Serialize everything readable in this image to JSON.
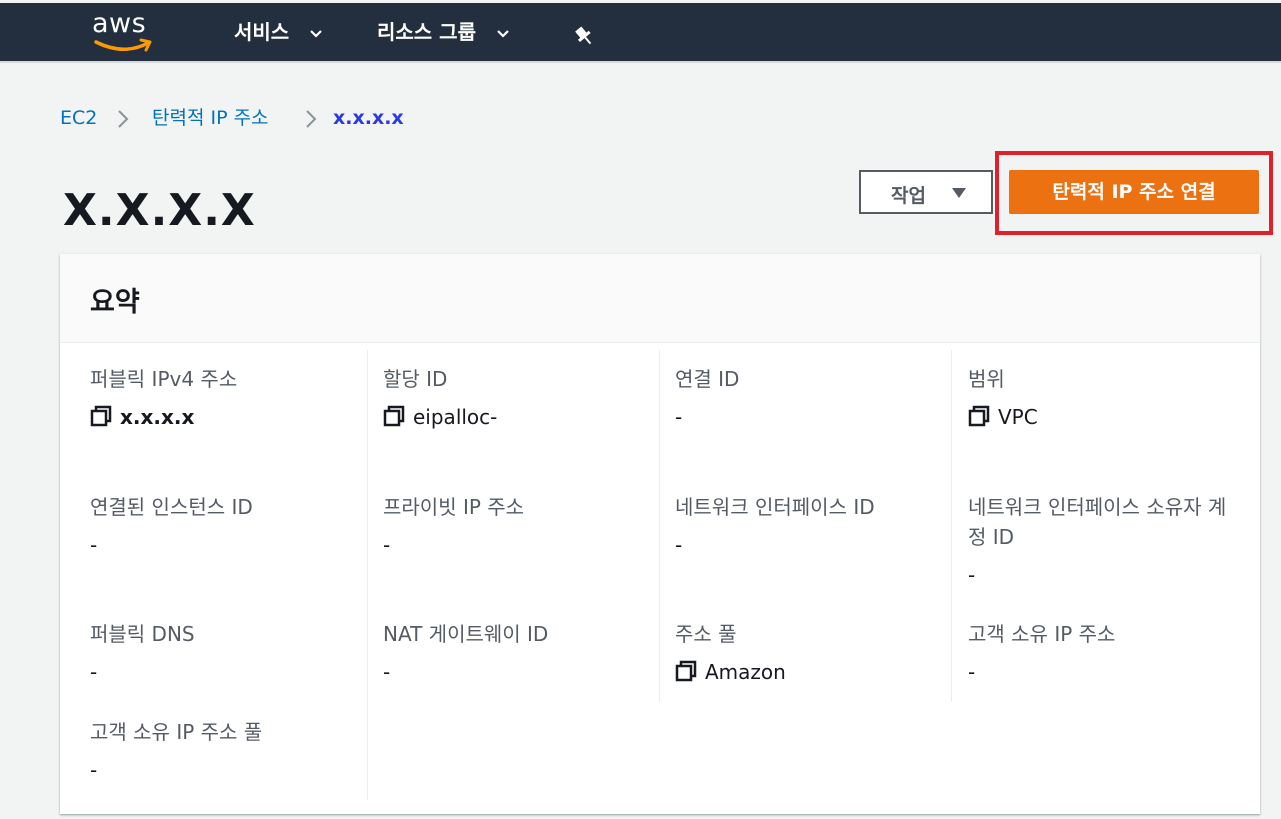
{
  "nav": {
    "logo_text": "aws",
    "services_label": "서비스",
    "resource_groups_label": "리소스 그룹",
    "pin_icon": "pin-icon"
  },
  "breadcrumb": {
    "items": [
      "EC2",
      "탄력적 IP 주소",
      "x.x.x.x"
    ]
  },
  "page": {
    "title": "X.X.X.X",
    "actions_label": "작업",
    "associate_label": "탄력적 IP 주소 연결"
  },
  "summary": {
    "title": "요약",
    "fields": [
      {
        "label": "퍼블릭 IPv4 주소",
        "value": "x.x.x.x",
        "copy": true
      },
      {
        "label": "할당 ID",
        "value": "eipalloc-",
        "copy": true
      },
      {
        "label": "연결 ID",
        "value": "-"
      },
      {
        "label": "범위",
        "value": "VPC",
        "copy": true
      },
      {
        "label": "연결된 인스턴스 ID",
        "value": "-"
      },
      {
        "label": "프라이빗 IP 주소",
        "value": "-"
      },
      {
        "label": "네트워크 인터페이스 ID",
        "value": "-"
      },
      {
        "label": "네트워크 인터페이스 소유자 계정 ID",
        "value": "-"
      },
      {
        "label": "퍼블릭 DNS",
        "value": "-"
      },
      {
        "label": "NAT 게이트웨이 ID",
        "value": "-"
      },
      {
        "label": "주소 풀",
        "value": "Amazon",
        "copy": true
      },
      {
        "label": "고객 소유 IP 주소",
        "value": "-"
      },
      {
        "label": "고객 소유 IP 주소 풀",
        "value": "-"
      }
    ]
  },
  "colors": {
    "nav_bg": "#232f3e",
    "primary": "#ec7211",
    "link": "#0073bb",
    "highlight": "#e0202a"
  }
}
